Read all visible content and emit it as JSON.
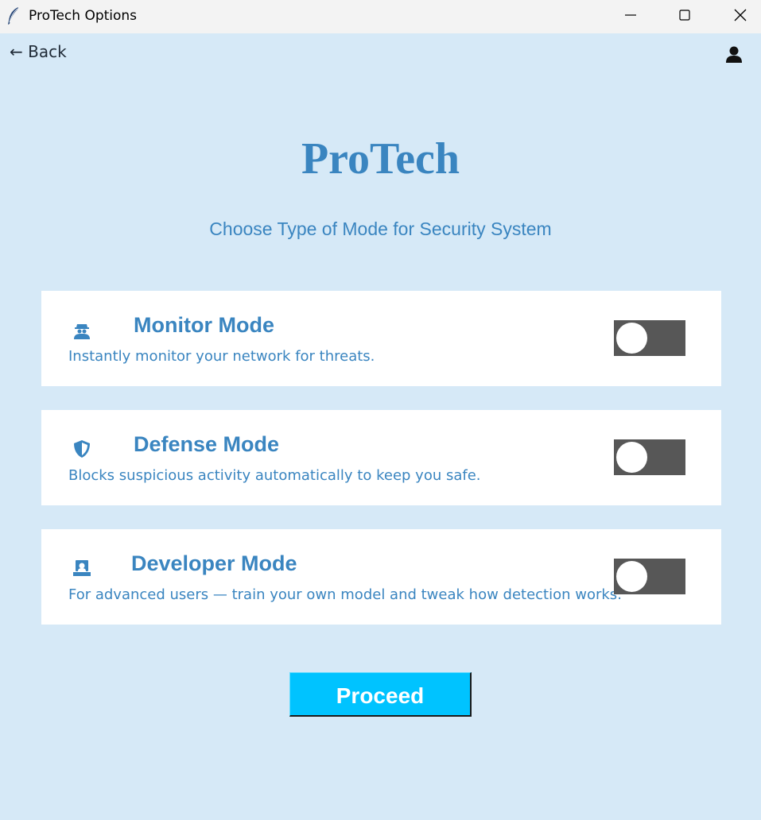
{
  "window": {
    "title": "ProTech Options",
    "app_icon": "feather-icon",
    "controls": [
      "minimize-icon",
      "maximize-icon",
      "close-icon"
    ]
  },
  "nav": {
    "back_label": "← Back",
    "user_icon": "user-icon"
  },
  "header": {
    "title": "ProTech",
    "subtitle": "Choose Type of Mode for Security System"
  },
  "modes": [
    {
      "title": "Monitor Mode",
      "description": "Instantly monitor your network for threats.",
      "icon": "spy-icon",
      "enabled": false
    },
    {
      "title": "Defense Mode",
      "description": "Blocks suspicious activity automatically to keep you safe.",
      "icon": "shield-icon",
      "enabled": false
    },
    {
      "title": "Developer Mode",
      "description": "For advanced users — train your own model and tweak how detection works.",
      "icon": "developer-icon",
      "enabled": false
    }
  ],
  "actions": {
    "proceed_label": "Proceed"
  },
  "colors": {
    "background": "#d6e9f7",
    "accent": "#3a85c0",
    "toggle_track": "#575757",
    "button": "#00c3ff"
  }
}
